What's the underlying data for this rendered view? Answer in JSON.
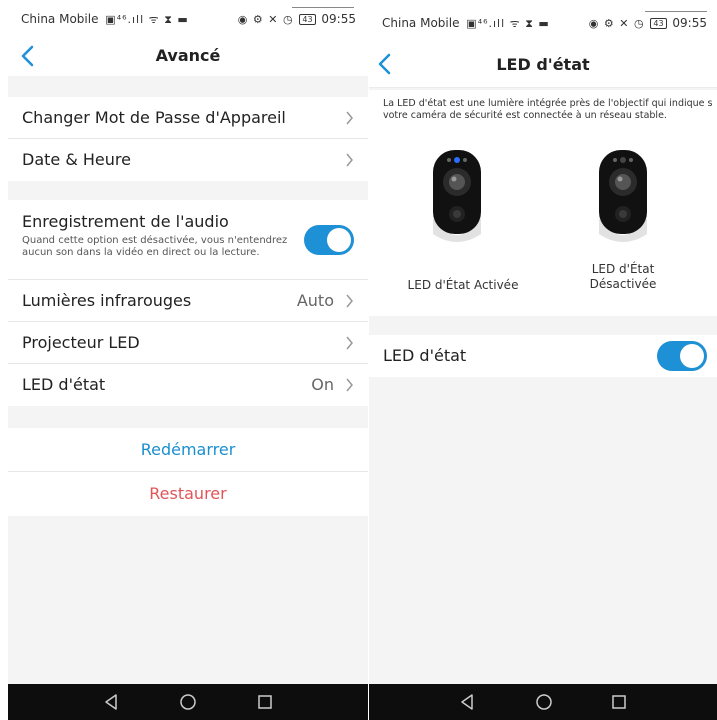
{
  "status_bar": {
    "carrier": "China Mobile",
    "time": "09:55",
    "battery": "43"
  },
  "left_screen": {
    "title": "Avancé",
    "group1": [
      {
        "label": "Changer Mot de Passe d'Appareil"
      },
      {
        "label": "Date & Heure"
      }
    ],
    "audio": {
      "label": "Enregistrement de l'audio",
      "description": "Quand cette option est désactivée, vous n'entendrez aucun son dans la vidéo en direct ou la lecture.",
      "enabled": true
    },
    "group2": [
      {
        "label": "Lumières infrarouges",
        "value": "Auto"
      },
      {
        "label": "Projecteur LED",
        "value": ""
      },
      {
        "label": "LED d'état",
        "value": "On"
      }
    ],
    "actions": {
      "restart": "Redémarrer",
      "reset": "Restaurer"
    }
  },
  "right_screen": {
    "title": "LED d'état",
    "info": {
      "line1": "La LED d'état est une lumière intégrée près de l'objectif qui indique s",
      "line2": "votre caméra de sécurité est connectée à un réseau stable."
    },
    "camera_on_caption": "LED d'État Activée",
    "camera_off_caption_1": "LED d'État",
    "camera_off_caption_2": "Désactivée",
    "led_toggle": {
      "label": "LED d'état",
      "enabled": true
    }
  },
  "colors": {
    "accent": "#1e90d6",
    "restart": "#1a8fd0",
    "reset": "#e05558",
    "background": "#f4f4f4"
  },
  "icons": [
    "back-icon",
    "chevron-right-icon",
    "nav-back-icon",
    "nav-home-icon",
    "nav-recents-icon"
  ]
}
